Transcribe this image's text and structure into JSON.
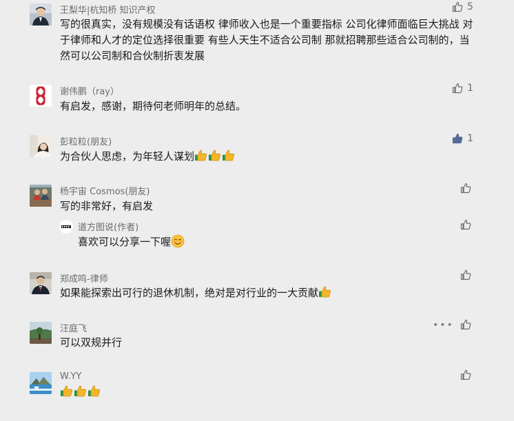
{
  "comments": [
    {
      "name": "王梨华|杭知桥 知识产权",
      "text": "写的很真实，没有规模没有话语权 律师收入也是一个重要指标 公司化律师面临巨大挑战 对于律师和人才的定位选择很重要 有些人天生不适合公司制 那就招聘那些适合公司制的，当然可以公司制和合伙制折衷发展",
      "likes": "5",
      "liked": false
    },
    {
      "name": "谢伟鹏（ray）",
      "text": "有启发，感谢，期待何老师明年的总结。",
      "likes": "1",
      "liked": false
    },
    {
      "name": "彭粒粒(朋友)",
      "text": "为合伙人思虑，为年轻人谋划",
      "likes": "1",
      "liked": true
    },
    {
      "name": "杨宇宙 Cosmos(朋友)",
      "text": "写的非常好，有启发",
      "likes": "",
      "liked": false,
      "reply": {
        "name": "道方图说(作者)",
        "text": "喜欢可以分享一下喔"
      }
    },
    {
      "name": "郑成鸣-律师",
      "text": "如果能探索出可行的退休机制，绝对是对行业的一大贡献",
      "likes": "",
      "liked": false
    },
    {
      "name": "汪庭飞",
      "text": "可以双规并行",
      "likes": "",
      "liked": false,
      "more": "•••"
    },
    {
      "name": "W.YY",
      "text": "",
      "likes": "",
      "liked": false
    }
  ],
  "colors": {
    "background": "#ededed",
    "name": "#6b6b6b",
    "text": "#1a1a1a",
    "like_icon": "#6b6b6b",
    "like_icon_active": "#576b95"
  },
  "icons": [
    "thumbs-up-icon",
    "thumbs-up-emoji",
    "smile-emoji",
    "more-icon"
  ]
}
